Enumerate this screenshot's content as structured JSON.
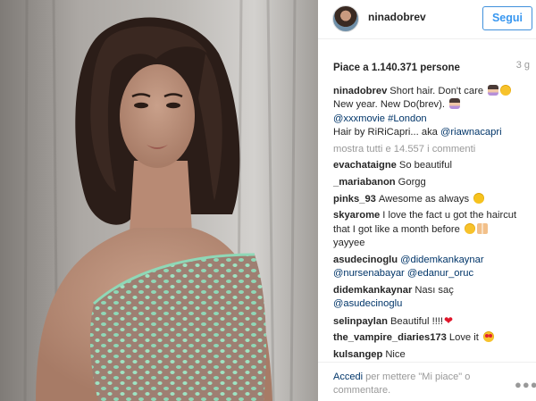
{
  "post": {
    "username": "ninadobrev",
    "follow_label": "Segui",
    "likes": "Piace a 1.140.371 persone",
    "time_ago": "3 g"
  },
  "caption": {
    "username": "ninadobrev",
    "line1": "Short hair. Don't care",
    "line2": "New year. New Do(brev).",
    "mention_movie": "@xxxmovie",
    "hashtag_london": "#London",
    "hair_by": "Hair by RiRiCapri... aka",
    "mention_riaw": "@riawnacapri"
  },
  "show_all_comments": "mostra tutti e 14.557 i commenti",
  "comments": [
    {
      "user": "evachataigne",
      "text": "So beautiful"
    },
    {
      "user": "_mariabanon",
      "text": "Gorgg"
    },
    {
      "user": "pinks_93",
      "text": "Awesome as always"
    },
    {
      "user": "skyarome",
      "text": "I love the fact u got the haircut that I got like a month before",
      "text2": "yayyee"
    },
    {
      "user": "asudecinoglu",
      "mention1": "@didemkankaynar",
      "mention2": "@nursenabayar",
      "mention3": "@edanur_oruc"
    },
    {
      "user": "didemkankaynar",
      "text": "Nası saç",
      "mention1": "@asudecinoglu"
    },
    {
      "user": "selinpaylan",
      "text": "Beautiful !!!!"
    },
    {
      "user": "the_vampire_diaries173",
      "text": "Love it"
    },
    {
      "user": "kulsangep",
      "text": "Nice"
    }
  ],
  "footer": {
    "login_label": "Accedi",
    "rest": "per mettere \"Mi piace\" o commentare."
  },
  "icons": {
    "more_options": "more-options-icon",
    "heart": "heart-icon"
  },
  "colors": {
    "follow_blue": "#3897f0",
    "link_blue": "#003569",
    "muted_gray": "#999999",
    "heart_red": "#e0162b"
  }
}
